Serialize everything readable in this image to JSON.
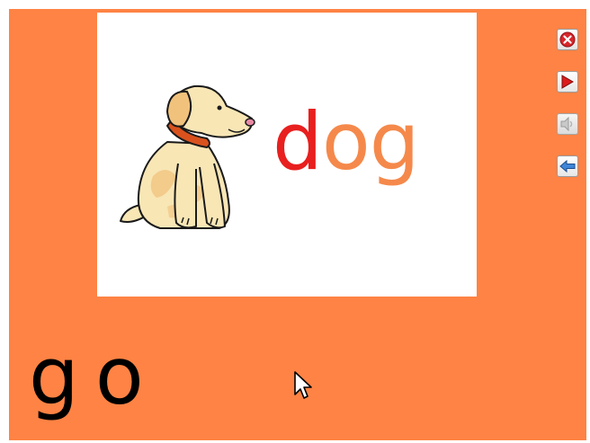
{
  "card": {
    "word_first_letter": "d",
    "word_rest": "og"
  },
  "toolbar": {
    "close": "close-icon",
    "play": "play-icon",
    "sound": "sound-icon",
    "back": "back-arrow-icon"
  },
  "bottom": {
    "text": "go"
  },
  "colors": {
    "background": "#ff8344",
    "card": "#ffffff",
    "first_letter": "#e8201f",
    "rest_letters": "#f5894b"
  }
}
